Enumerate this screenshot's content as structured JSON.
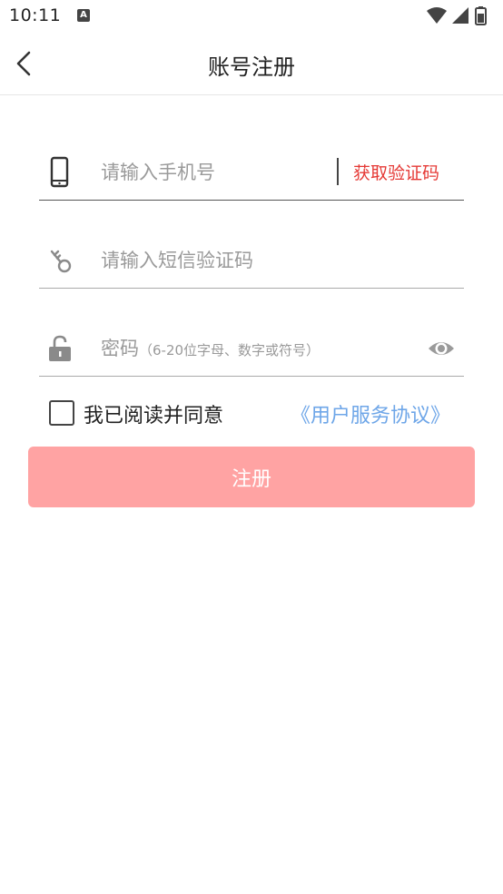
{
  "status_bar": {
    "time": "10:11",
    "app_icon_letter": "A",
    "icons": [
      "wifi-icon",
      "signal-icon",
      "battery-icon"
    ]
  },
  "app_bar": {
    "title": "账号注册",
    "back_icon": "chevron-left-icon"
  },
  "form": {
    "phone": {
      "icon": "phone-icon",
      "placeholder": "请输入手机号",
      "value": "",
      "get_code_label": "获取验证码"
    },
    "sms_code": {
      "icon": "key-icon",
      "placeholder": "请输入短信验证码",
      "value": ""
    },
    "password": {
      "icon": "lock-icon",
      "label": "密码",
      "hint": "（6-20位字母、数字或符号）",
      "value": "",
      "toggle_icon": "eye-icon"
    }
  },
  "agreement": {
    "checked": false,
    "text": "我已阅读并同意",
    "link_text": "《用户服务协议》"
  },
  "register_button": {
    "label": "注册"
  },
  "colors": {
    "accent_red": "#e53935",
    "button_disabled": "#ffa3a3",
    "link_blue": "#6ea6e8",
    "placeholder_gray": "#9a9a9a"
  }
}
